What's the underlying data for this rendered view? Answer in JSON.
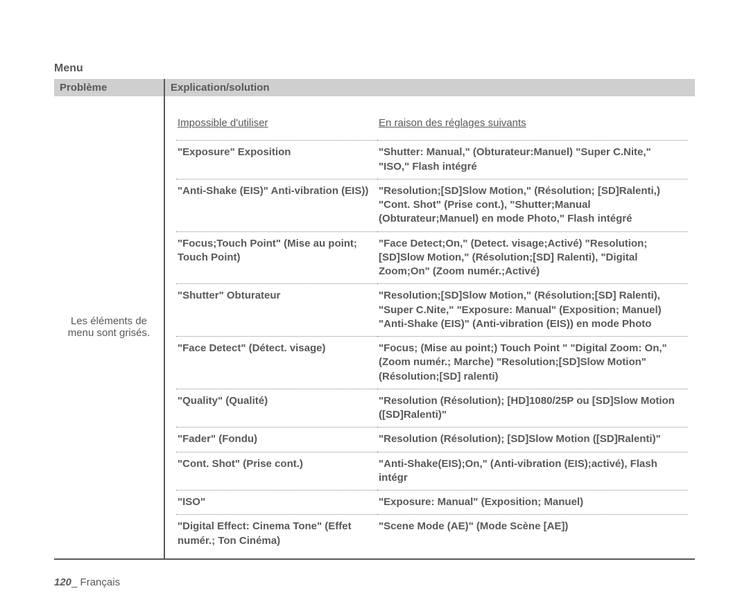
{
  "section_title": "Menu",
  "table_header": {
    "problem": "Problème",
    "explanation": "Explication/solution"
  },
  "problem_text": "Les éléments de menu sont grisés.",
  "inner_header": {
    "c1": "Impossible d'utiliser",
    "c2": "En raison des réglages suivants"
  },
  "rows": [
    {
      "c1": "\"Exposure\" Exposition",
      "c2": "\"Shutter: Manual,\" (Obturateur:Manuel) \"Super C.Nite,\" \"ISO,\" Flash intégré"
    },
    {
      "c1": "\"Anti-Shake (EIS)\" Anti-vibration (EIS))",
      "c2": "\"Resolution;[SD]Slow Motion,\" (Résolution; [SD]Ralenti,) \"Cont. Shot\" (Prise cont.), \"Shutter;Manual (Obturateur;Manuel) en mode Photo,\" Flash intégré"
    },
    {
      "c1": "\"Focus;Touch Point\" (Mise au point; Touch Point)",
      "c2": "\"Face Detect;On,\" (Detect. visage;Activé) \"Resolution;[SD]Slow Motion,\" (Résolution;[SD] Ralenti), \"Digital Zoom;On\" (Zoom numér.;Activé)"
    },
    {
      "c1": "\"Shutter\" Obturateur",
      "c2": "\"Resolution;[SD]Slow Motion,\" (Résolution;[SD] Ralenti), \"Super C.Nite,\" \"Exposure: Manual\" (Exposition; Manuel) \"Anti-Shake (EIS)\" (Anti-vibration (EIS)) en mode Photo"
    },
    {
      "c1": "\"Face Detect\" (Détect. visage)",
      "c2": "\"Focus; (Mise au point;) Touch Point \" \"Digital Zoom: On,\" (Zoom numér.; Marche) \"Resolution;[SD]Slow Motion\" (Résolution;[SD] ralenti)"
    },
    {
      "c1": "\"Quality\" (Qualité)",
      "c2": "\"Resolution (Résolution); [HD]1080/25P ou [SD]Slow Motion ([SD]Ralenti)\""
    },
    {
      "c1": "\"Fader\" (Fondu)",
      "c2": "\"Resolution (Résolution); [SD]Slow Motion ([SD]Ralenti)\""
    },
    {
      "c1": "\"Cont. Shot\" (Prise cont.)",
      "c2": "\"Anti-Shake(EIS);On,\" (Anti-vibration (EIS);activé), Flash intégr"
    },
    {
      "c1": "\"ISO\"",
      "c2": "\"Exposure: Manual\" (Exposition; Manuel)"
    },
    {
      "c1": "\"Digital Effect: Cinema Tone\" (Effet numér.; Ton Cinéma)",
      "c2": "\"Scene Mode (AE)\" (Mode Scène [AE])"
    }
  ],
  "footer": {
    "page_number": "120",
    "sep": "_ ",
    "lang": "Français"
  }
}
